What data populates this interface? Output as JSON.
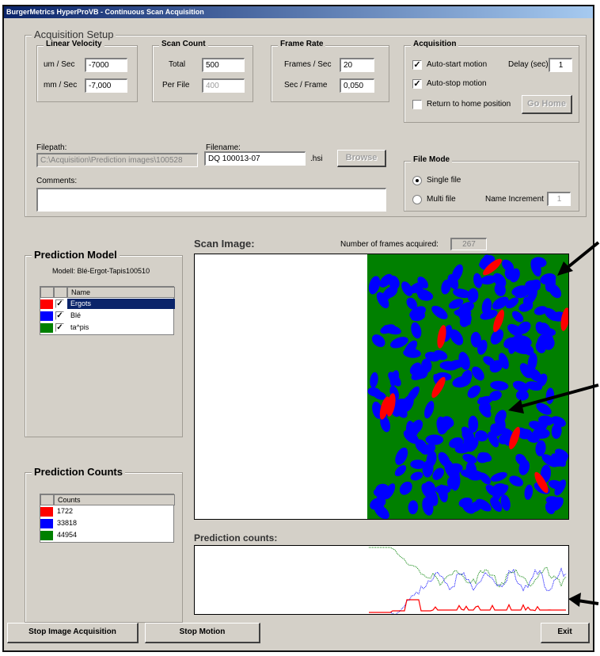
{
  "window": {
    "title": "BurgerMetrics HyperProVB  - Continuous Scan Acquisition"
  },
  "setup": {
    "title": "Acquisition Setup",
    "linear_velocity": {
      "title": "Linear Velocity",
      "um_label": "um / Sec",
      "um_value": "-7000",
      "mm_label": "mm / Sec",
      "mm_value": "-7,000"
    },
    "scan_count": {
      "title": "Scan Count",
      "total_label": "Total",
      "total_value": "500",
      "per_file_label": "Per File",
      "per_file_value": "400"
    },
    "frame_rate": {
      "title": "Frame Rate",
      "fps_label": "Frames / Sec",
      "fps_value": "20",
      "spf_label": "Sec / Frame",
      "spf_value": "0,050"
    },
    "acquisition": {
      "title": "Acquisition",
      "auto_start_label": "Auto-start motion",
      "auto_start_checked": true,
      "delay_label": "Delay (sec):",
      "delay_value": "1",
      "auto_stop_label": "Auto-stop motion",
      "auto_stop_checked": true,
      "return_home_label": "Return to home position",
      "return_home_checked": false,
      "go_home_label": "Go Home"
    },
    "filepath_label": "Filepath:",
    "filepath_value": "C:\\Acquisition\\Prediction images\\100528",
    "filename_label": "Filename:",
    "filename_value": "DQ 100013-07",
    "extension": ".hsi",
    "browse_label": "Browse",
    "comments_label": "Comments:",
    "comments_value": "",
    "file_mode": {
      "title": "File Mode",
      "single_label": "Single file",
      "multi_label": "Multi file",
      "selected": "single",
      "name_increment_label": "Name Increment",
      "name_increment_value": "1"
    }
  },
  "prediction_model": {
    "title": "Prediction Model",
    "model_line": "Modell: Blé-Ergot-Tapis100510",
    "column_name": "Name",
    "classes": [
      {
        "name": "Ergots",
        "color": "#ff0000",
        "checked": true,
        "selected": true
      },
      {
        "name": "Blé",
        "color": "#0000ff",
        "checked": true,
        "selected": false
      },
      {
        "name": "ta^pis",
        "color": "#008000",
        "checked": true,
        "selected": false
      }
    ]
  },
  "prediction_counts_box": {
    "title": "Prediction Counts",
    "column_name": "Counts",
    "rows": [
      {
        "value": "1722",
        "color": "#ff0000"
      },
      {
        "value": "33818",
        "color": "#0000ff"
      },
      {
        "value": "44954",
        "color": "#008000"
      }
    ]
  },
  "scan": {
    "title": "Scan Image:",
    "frames_label": "Number of frames acquired:",
    "frames_value": "267"
  },
  "counts_plot": {
    "title": "Prediction counts:"
  },
  "buttons": {
    "stop_acquisition": "Stop Image Acquisition",
    "stop_motion": "Stop Motion",
    "exit": "Exit"
  },
  "colors": {
    "window_bg": "#d4d0c8",
    "ergot": "#ff0000",
    "wheat": "#0000ff",
    "belt": "#008000",
    "title_start": "#0a246a"
  }
}
